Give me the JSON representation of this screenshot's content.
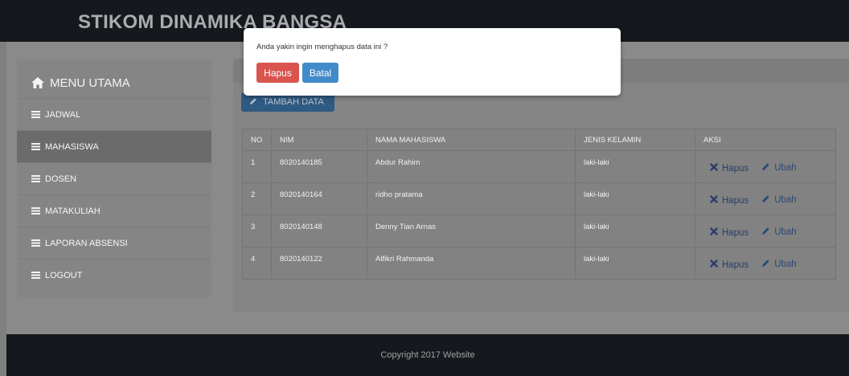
{
  "header": {
    "brand": "STIKOM DINAMIKA BANGSA"
  },
  "sidebar": {
    "title": "MENU UTAMA",
    "items": [
      {
        "label": "JADWAL"
      },
      {
        "label": "MAHASISWA",
        "active": true
      },
      {
        "label": "DOSEN"
      },
      {
        "label": "MATAKULIAH"
      },
      {
        "label": "LAPORAN ABSENSI"
      },
      {
        "label": "LOGOUT"
      }
    ]
  },
  "toolbar": {
    "add_label": "TAMBAH DATA"
  },
  "table": {
    "headers": [
      "NO",
      "NIM",
      "NAMA MAHASISWA",
      "JENIS KELAMIN",
      "AKSI"
    ],
    "rows": [
      {
        "no": "1",
        "nim": "8020140185",
        "nama": "Abdur Rahim",
        "jk": "laki-laki"
      },
      {
        "no": "2",
        "nim": "8020140164",
        "nama": "ridho pratama",
        "jk": "laki-laki"
      },
      {
        "no": "3",
        "nim": "8020140148",
        "nama": "Denny Tian Arnas",
        "jk": "laki-laki"
      },
      {
        "no": "4",
        "nim": "8020140122",
        "nama": "Alfikri Rahmanda",
        "jk": "laki-laki"
      }
    ],
    "action_delete": "Hapus",
    "action_edit": "Ubah"
  },
  "footer": {
    "text": "Copyright 2017",
    "link": "Website"
  },
  "modal": {
    "message": "Anda yakin ingin menghapus data ini ?",
    "confirm_label": "Hapus",
    "cancel_label": "Batal"
  },
  "colors": {
    "danger": "#d9534f",
    "primary": "#428bca",
    "header": "#15181c"
  }
}
